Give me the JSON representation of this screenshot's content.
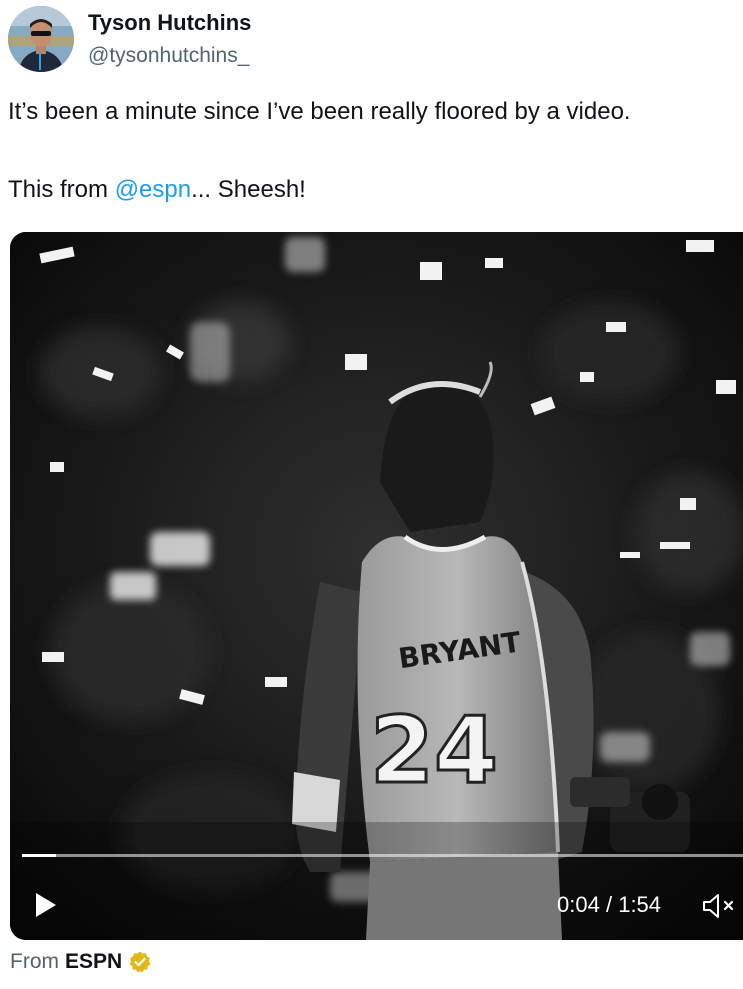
{
  "author": {
    "name": "Tyson Hutchins",
    "handle": "@tysonhutchins_"
  },
  "tweet": {
    "line1": "It’s been a minute since I’ve been really floored by a video.",
    "line2_prefix": "This from ",
    "line2_mention": "@espn",
    "line2_suffix": "... Sheesh!"
  },
  "video": {
    "jersey_name": "BRYANT",
    "jersey_number": "24",
    "current_time": "0:04",
    "separator": "/",
    "duration": "1:54",
    "progress_fraction": 0.047,
    "play_icon": "play-icon",
    "mute_icon": "speaker-muted-icon"
  },
  "source": {
    "prefix": "From",
    "name": "ESPN",
    "badge_icon": "verified-gold-badge-icon",
    "badge_color": "#e2b719"
  },
  "colors": {
    "link": "#1d9bf0",
    "secondary_text": "#536471",
    "primary_text": "#0f1419"
  }
}
